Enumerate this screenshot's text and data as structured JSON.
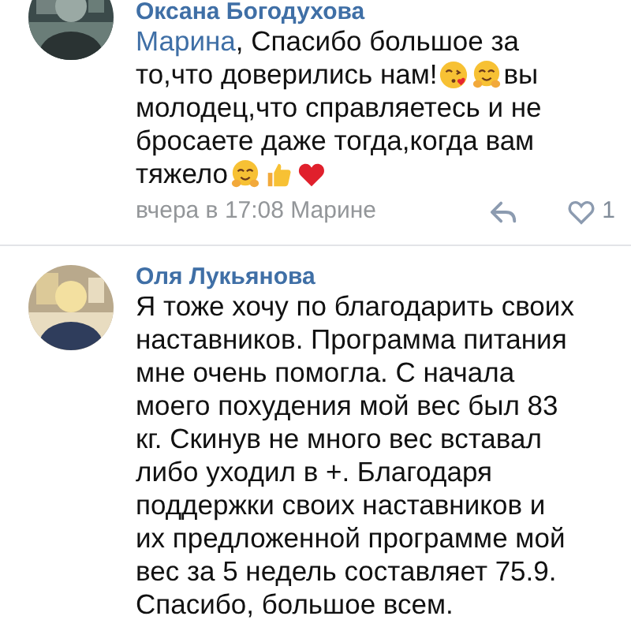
{
  "comments": [
    {
      "author": "Оксана Богодухова",
      "avatar": {
        "kind": "picture"
      },
      "lines": [
        [
          {
            "kind": "mention",
            "text": "Марина"
          },
          {
            "kind": "text",
            "text": ", Спасибо большое за"
          }
        ],
        [
          {
            "kind": "text",
            "text": "то,что доверились нам!"
          },
          {
            "kind": "kiss-emoji"
          },
          {
            "kind": "hug-emoji"
          },
          {
            "kind": "text",
            "text": "вы"
          }
        ],
        [
          {
            "kind": "text",
            "text": "молодец,что справляетесь и не"
          }
        ],
        [
          {
            "kind": "text",
            "text": "бросаете даже тогда,когда вам"
          }
        ],
        [
          {
            "kind": "text",
            "text": "тяжело"
          },
          {
            "kind": "hug-emoji"
          },
          {
            "kind": "thumbs-emoji"
          },
          {
            "kind": "heart-emoji"
          }
        ]
      ],
      "meta": "вчера в 17:08 Марине",
      "likes": "1",
      "liked": false
    },
    {
      "author": "Оля Лукьянова",
      "avatar": {
        "kind": "picture"
      },
      "lines": [
        [
          {
            "kind": "text",
            "text": "Я тоже хочу по благодарить своих"
          }
        ],
        [
          {
            "kind": "text",
            "text": "наставников. Программа питания"
          }
        ],
        [
          {
            "kind": "text",
            "text": "мне очень помогла. С начала"
          }
        ],
        [
          {
            "kind": "text",
            "text": "моего похудения мой вес был 83"
          }
        ],
        [
          {
            "kind": "text",
            "text": "кг. Скинув не много вес вставал"
          }
        ],
        [
          {
            "kind": "text",
            "text": "либо уходил в +. Благодаря"
          }
        ],
        [
          {
            "kind": "text",
            "text": "поддержки своих наставников и"
          }
        ],
        [
          {
            "kind": "text",
            "text": "их предложенной программе мой"
          }
        ],
        [
          {
            "kind": "text",
            "text": "вес за 5 недель составляет 75.9."
          }
        ],
        [
          {
            "kind": "text",
            "text": "Спасибо, большое всем."
          }
        ]
      ]
    }
  ]
}
